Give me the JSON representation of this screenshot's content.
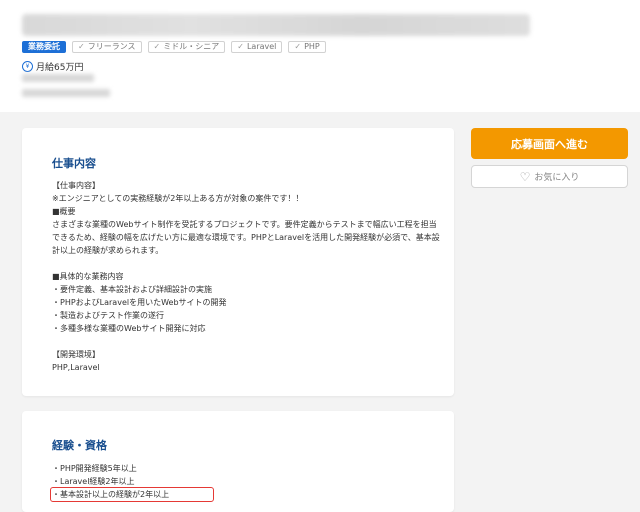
{
  "header": {
    "tags_main": "業務委託",
    "tags": [
      "フリーランス",
      "ミドル・シニア",
      "Laravel",
      "PHP"
    ],
    "salary": "月給65万円"
  },
  "actions": {
    "apply_label": "応募画面へ進む",
    "favorite_label": "お気に入り"
  },
  "job": {
    "title": "仕事内容",
    "body": "【仕事内容】\n※エンジニアとしての実務経験が2年以上ある方が対象の案件です！！\n■概要\nさまざまな業種のWebサイト制作を受託するプロジェクトです。要件定義からテストまで幅広い工程を担当できるため、経験の幅を広げたい方に最適な環境です。PHPとLaravelを活用した開発経験が必須で、基本設計以上の経験が求められます。\n\n■具体的な業務内容\n・要件定義、基本設計および詳細設計の実施\n・PHPおよびLaravelを用いたWebサイトの開発\n・製造およびテスト作業の遂行\n・多種多様な業種のWebサイト開発に対応\n\n【開発環境】\nPHP,Laravel"
  },
  "experience": {
    "title": "経験・資格",
    "items": [
      "・PHP開発経験5年以上",
      "・Laravel経験2年以上",
      "・基本設計以上の経験が2年以上"
    ]
  }
}
